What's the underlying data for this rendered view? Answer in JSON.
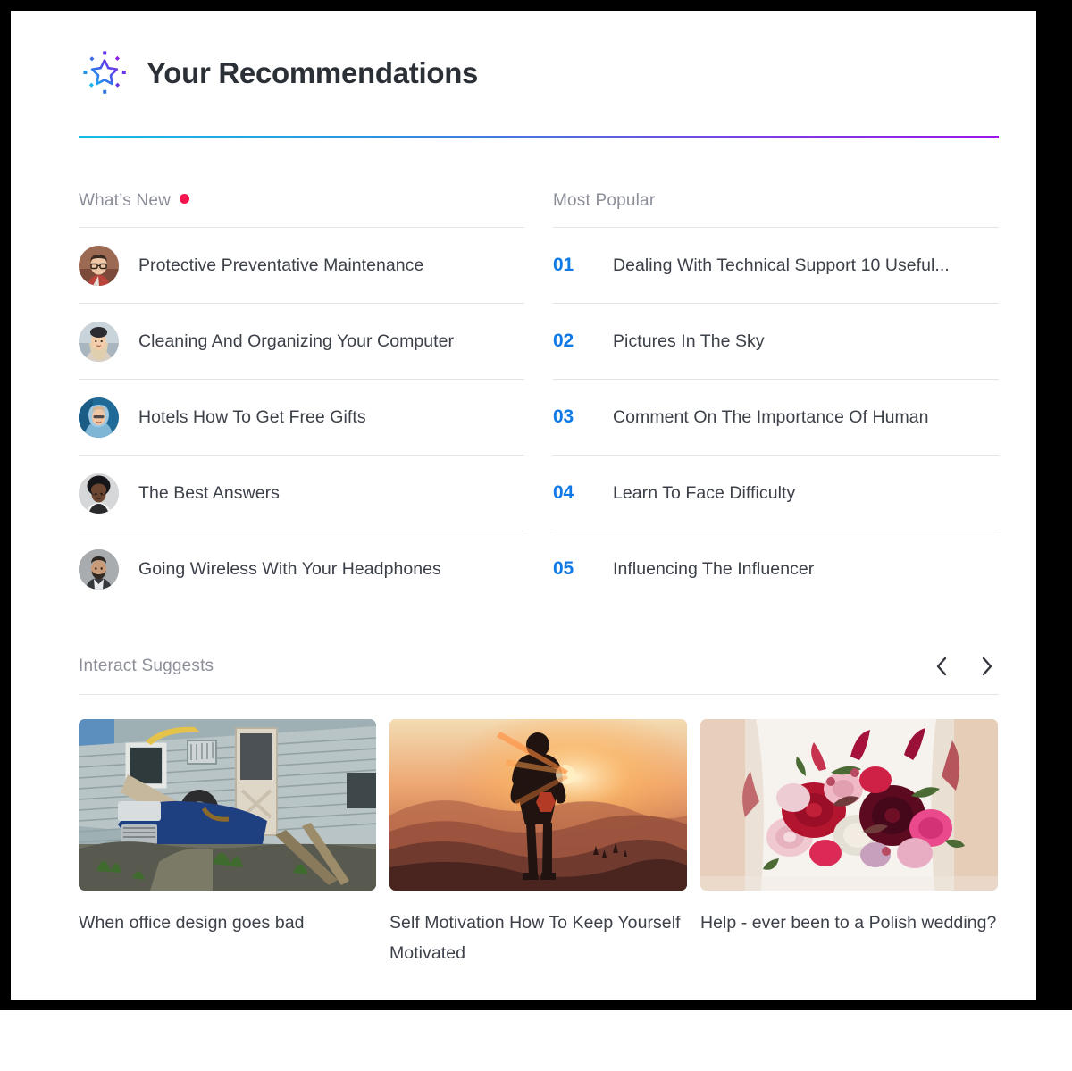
{
  "header": {
    "title": "Your Recommendations",
    "icon": "sparkle-star-icon",
    "rule_gradient_from": "#14bde8",
    "rule_gradient_to": "#9b15ea"
  },
  "whats_new": {
    "heading": "What’s New",
    "badge_color": "#f5154e",
    "items": [
      {
        "title": "Protective Preventative Maintenance",
        "avatar": "man-with-glasses-avatar"
      },
      {
        "title": "Cleaning And Organizing Your Computer",
        "avatar": "woman-with-beanie-avatar"
      },
      {
        "title": "Hotels How To Get Free Gifts",
        "avatar": "woman-in-blue-hoodie-avatar"
      },
      {
        "title": "The Best Answers",
        "avatar": "person-with-afro-avatar"
      },
      {
        "title": "Going Wireless With Your Headphones",
        "avatar": "bearded-man-avatar"
      }
    ]
  },
  "most_popular": {
    "heading": "Most Popular",
    "rank_color": "#0f7ae5",
    "items": [
      {
        "rank": "01",
        "title": "Dealing With Technical Support 10 Useful..."
      },
      {
        "rank": "02",
        "title": "Pictures In The Sky"
      },
      {
        "rank": "03",
        "title": "Comment On The Importance Of Human"
      },
      {
        "rank": "04",
        "title": "Learn To Face Difficulty"
      },
      {
        "rank": "05",
        "title": "Influencing The Influencer"
      }
    ]
  },
  "interact_suggests": {
    "heading": "Interact Suggests",
    "prev_label": "‹",
    "next_label": "›",
    "cards": [
      {
        "title": "When office design goes bad",
        "image": "collapsed-house-with-overturned-car-photo"
      },
      {
        "title": "Self Motivation How To Keep Yourself Motivated",
        "image": "person-silhouette-at-sunset-on-mountain-photo"
      },
      {
        "title": "Help - ever been to a Polish wedding?",
        "image": "bridal-bouquet-of-red-and-pink-flowers-photo"
      }
    ]
  }
}
